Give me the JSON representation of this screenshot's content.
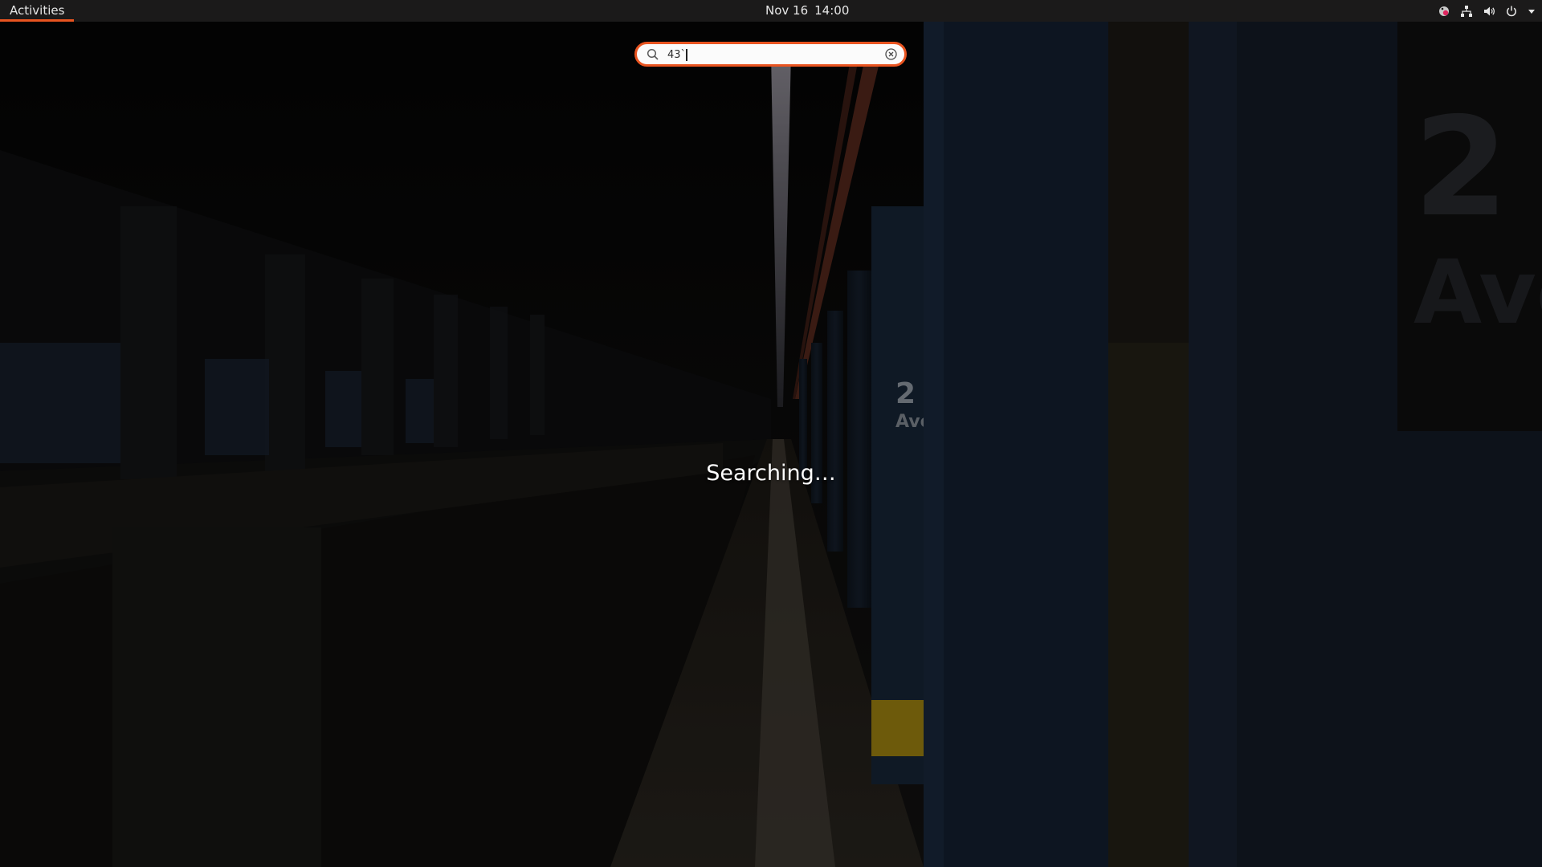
{
  "topbar": {
    "activities_label": "Activities",
    "date": "Nov 16",
    "time": "14:00",
    "tray_icons": [
      "accessibility-icon",
      "network-icon",
      "volume-icon",
      "power-icon",
      "chevron-down-icon"
    ]
  },
  "search": {
    "value": "43`",
    "placeholder": ""
  },
  "status": {
    "text": "Searching…"
  },
  "colors": {
    "accent": "#e95420",
    "topbar": "#1b1a1a",
    "text": "#ffffff"
  }
}
